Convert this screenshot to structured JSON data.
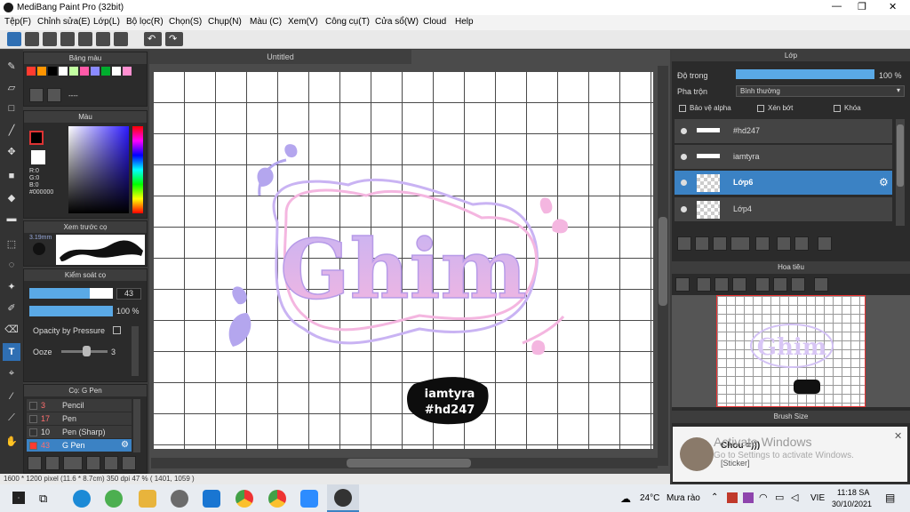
{
  "window": {
    "title": "MediBang Paint Pro (32bit)",
    "min": "—",
    "max": "❐",
    "close": "✕"
  },
  "menu": [
    "Tệp(F)",
    "Chỉnh sửa(E)",
    "Lớp(L)",
    "Bộ lọc(R)",
    "Chọn(S)",
    "Chụp(N)",
    "Màu (C)",
    "Xem(V)",
    "Công cụ(T)",
    "Cửa sổ(W)",
    "Cloud",
    "Help"
  ],
  "canvas_tab": "Untitled",
  "palette": {
    "title": "Bảng màu",
    "colors": [
      "#ff3b30",
      "#ff9500",
      "#000000",
      "#ffffff",
      "#c2ffa1",
      "#ff5aa8",
      "#8a8aff",
      "#00ad2e",
      "#ffffff",
      "#ff8fd0"
    ],
    "label": "----"
  },
  "color_panel": {
    "title": "Màu",
    "r": "R:0",
    "g": "G:0",
    "b": "B:0",
    "hex": "#000000"
  },
  "brush_preview": {
    "title": "Xem trước cọ",
    "size": "3.19mm"
  },
  "brush_control": {
    "title": "Kiểm soát cọ",
    "size": "43",
    "opacity": "100 %",
    "pressure_label": "Opacity by Pressure",
    "ooze_label": "Ooze",
    "ooze_value": "3",
    "size_fill": 0.72,
    "opacity_fill": 1.0
  },
  "brush_list": {
    "title": "Cọ: G Pen",
    "items": [
      {
        "size": "3",
        "name": "Pencil",
        "color": "#333333"
      },
      {
        "size": "17",
        "name": "Pen",
        "color": "#333333"
      },
      {
        "size": "10",
        "name": "Pen (Sharp)",
        "color": "#333333"
      },
      {
        "size": "43",
        "name": "G Pen",
        "color": "#ff3b30"
      }
    ]
  },
  "layers_panel": {
    "title": "Lớp",
    "opacity_label": "Độ trong",
    "opacity_value": "100 %",
    "opacity_fill": 1.0,
    "blend_label": "Pha trộn",
    "blend_value": "Bình thường",
    "protect_alpha": "Bảo vệ alpha",
    "clipping": "Xén bớt",
    "lock": "Khóa",
    "layers": [
      {
        "name": "#hd247",
        "selected": false
      },
      {
        "name": "iamtyra",
        "selected": false
      },
      {
        "name": "Lớp6",
        "selected": true
      },
      {
        "name": "Lớp4",
        "selected": false
      }
    ]
  },
  "navigator": {
    "title": "Hoa tiêu"
  },
  "brush_size_panel": {
    "title": "Brush Size"
  },
  "artwork": {
    "main_text": "Ghim",
    "sticker_line1": "iamtyra",
    "sticker_line2": "#hd247"
  },
  "notification": {
    "sender": "Chou =)))",
    "message": "[Sticker]",
    "watermark1": "Activate Windows",
    "watermark2": "Go to Settings to activate Windows."
  },
  "status": "1600 * 1200 pixel   (11.6 * 8.7cm)   350 dpi   47 %   ( 1401, 1059 )",
  "taskbar": {
    "weather_temp": "24°C",
    "weather_text": "Mưa rào",
    "lang": "VIE",
    "time": "11:18 SA",
    "date": "30/10/2021"
  }
}
